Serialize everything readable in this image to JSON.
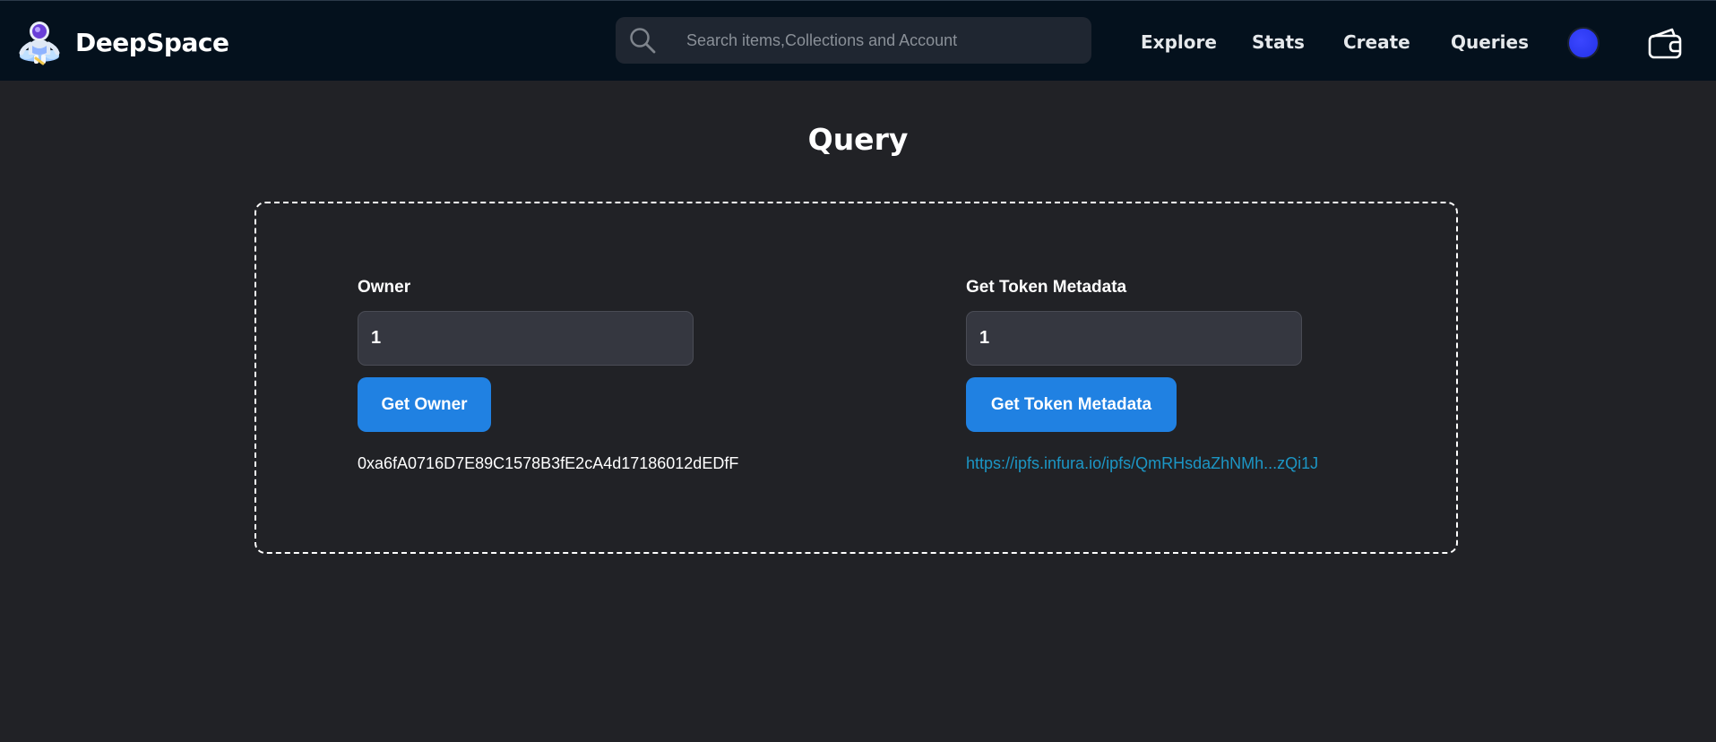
{
  "header": {
    "brand_name": "DeepSpace",
    "logo_icon": "astronaut-logo-icon",
    "search": {
      "icon": "search-icon",
      "placeholder": "Search items,Collections and Account",
      "value": ""
    },
    "nav": {
      "explore": "Explore",
      "stats": "Stats",
      "create": "Create",
      "queries": "Queries"
    },
    "avatar_color": "#2b3af0",
    "wallet_icon": "wallet-icon"
  },
  "main": {
    "title": "Query",
    "owner": {
      "label": "Owner",
      "input_value": "1",
      "button_label": "Get Owner",
      "result": "0xa6fA0716D7E89C1578B3fE2cA4d17186012dEDfF"
    },
    "metadata": {
      "label": "Get Token Metadata",
      "input_value": "1",
      "button_label": "Get Token Metadata",
      "result_link": "https://ipfs.infura.io/ipfs/QmRHsdaZhNMh...zQi1J"
    }
  },
  "colors": {
    "background": "#212226",
    "navbar": "#04111d",
    "accent": "#2081e2",
    "link": "#1c96c5"
  }
}
